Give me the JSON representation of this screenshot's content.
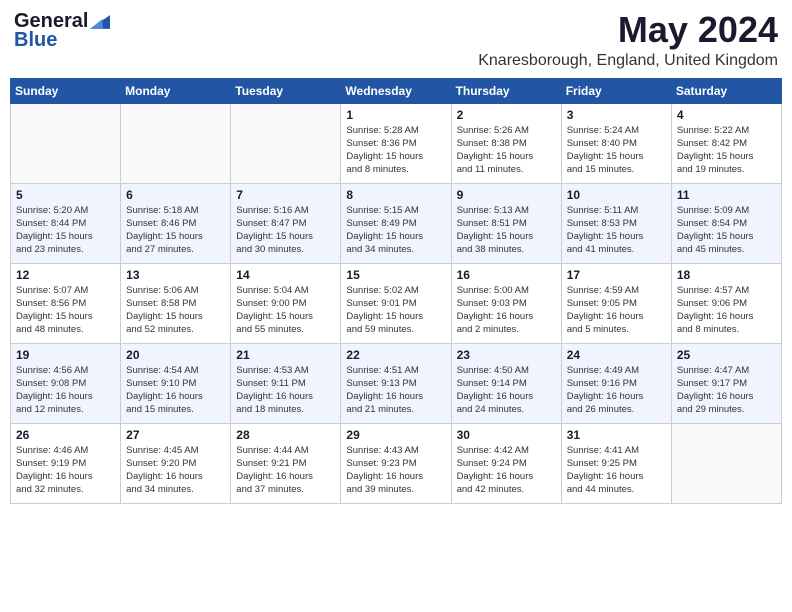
{
  "header": {
    "logo_general": "General",
    "logo_blue": "Blue",
    "month": "May 2024",
    "location": "Knaresborough, England, United Kingdom"
  },
  "days_of_week": [
    "Sunday",
    "Monday",
    "Tuesday",
    "Wednesday",
    "Thursday",
    "Friday",
    "Saturday"
  ],
  "weeks": [
    [
      {
        "day": "",
        "info": ""
      },
      {
        "day": "",
        "info": ""
      },
      {
        "day": "",
        "info": ""
      },
      {
        "day": "1",
        "info": "Sunrise: 5:28 AM\nSunset: 8:36 PM\nDaylight: 15 hours\nand 8 minutes."
      },
      {
        "day": "2",
        "info": "Sunrise: 5:26 AM\nSunset: 8:38 PM\nDaylight: 15 hours\nand 11 minutes."
      },
      {
        "day": "3",
        "info": "Sunrise: 5:24 AM\nSunset: 8:40 PM\nDaylight: 15 hours\nand 15 minutes."
      },
      {
        "day": "4",
        "info": "Sunrise: 5:22 AM\nSunset: 8:42 PM\nDaylight: 15 hours\nand 19 minutes."
      }
    ],
    [
      {
        "day": "5",
        "info": "Sunrise: 5:20 AM\nSunset: 8:44 PM\nDaylight: 15 hours\nand 23 minutes."
      },
      {
        "day": "6",
        "info": "Sunrise: 5:18 AM\nSunset: 8:46 PM\nDaylight: 15 hours\nand 27 minutes."
      },
      {
        "day": "7",
        "info": "Sunrise: 5:16 AM\nSunset: 8:47 PM\nDaylight: 15 hours\nand 30 minutes."
      },
      {
        "day": "8",
        "info": "Sunrise: 5:15 AM\nSunset: 8:49 PM\nDaylight: 15 hours\nand 34 minutes."
      },
      {
        "day": "9",
        "info": "Sunrise: 5:13 AM\nSunset: 8:51 PM\nDaylight: 15 hours\nand 38 minutes."
      },
      {
        "day": "10",
        "info": "Sunrise: 5:11 AM\nSunset: 8:53 PM\nDaylight: 15 hours\nand 41 minutes."
      },
      {
        "day": "11",
        "info": "Sunrise: 5:09 AM\nSunset: 8:54 PM\nDaylight: 15 hours\nand 45 minutes."
      }
    ],
    [
      {
        "day": "12",
        "info": "Sunrise: 5:07 AM\nSunset: 8:56 PM\nDaylight: 15 hours\nand 48 minutes."
      },
      {
        "day": "13",
        "info": "Sunrise: 5:06 AM\nSunset: 8:58 PM\nDaylight: 15 hours\nand 52 minutes."
      },
      {
        "day": "14",
        "info": "Sunrise: 5:04 AM\nSunset: 9:00 PM\nDaylight: 15 hours\nand 55 minutes."
      },
      {
        "day": "15",
        "info": "Sunrise: 5:02 AM\nSunset: 9:01 PM\nDaylight: 15 hours\nand 59 minutes."
      },
      {
        "day": "16",
        "info": "Sunrise: 5:00 AM\nSunset: 9:03 PM\nDaylight: 16 hours\nand 2 minutes."
      },
      {
        "day": "17",
        "info": "Sunrise: 4:59 AM\nSunset: 9:05 PM\nDaylight: 16 hours\nand 5 minutes."
      },
      {
        "day": "18",
        "info": "Sunrise: 4:57 AM\nSunset: 9:06 PM\nDaylight: 16 hours\nand 8 minutes."
      }
    ],
    [
      {
        "day": "19",
        "info": "Sunrise: 4:56 AM\nSunset: 9:08 PM\nDaylight: 16 hours\nand 12 minutes."
      },
      {
        "day": "20",
        "info": "Sunrise: 4:54 AM\nSunset: 9:10 PM\nDaylight: 16 hours\nand 15 minutes."
      },
      {
        "day": "21",
        "info": "Sunrise: 4:53 AM\nSunset: 9:11 PM\nDaylight: 16 hours\nand 18 minutes."
      },
      {
        "day": "22",
        "info": "Sunrise: 4:51 AM\nSunset: 9:13 PM\nDaylight: 16 hours\nand 21 minutes."
      },
      {
        "day": "23",
        "info": "Sunrise: 4:50 AM\nSunset: 9:14 PM\nDaylight: 16 hours\nand 24 minutes."
      },
      {
        "day": "24",
        "info": "Sunrise: 4:49 AM\nSunset: 9:16 PM\nDaylight: 16 hours\nand 26 minutes."
      },
      {
        "day": "25",
        "info": "Sunrise: 4:47 AM\nSunset: 9:17 PM\nDaylight: 16 hours\nand 29 minutes."
      }
    ],
    [
      {
        "day": "26",
        "info": "Sunrise: 4:46 AM\nSunset: 9:19 PM\nDaylight: 16 hours\nand 32 minutes."
      },
      {
        "day": "27",
        "info": "Sunrise: 4:45 AM\nSunset: 9:20 PM\nDaylight: 16 hours\nand 34 minutes."
      },
      {
        "day": "28",
        "info": "Sunrise: 4:44 AM\nSunset: 9:21 PM\nDaylight: 16 hours\nand 37 minutes."
      },
      {
        "day": "29",
        "info": "Sunrise: 4:43 AM\nSunset: 9:23 PM\nDaylight: 16 hours\nand 39 minutes."
      },
      {
        "day": "30",
        "info": "Sunrise: 4:42 AM\nSunset: 9:24 PM\nDaylight: 16 hours\nand 42 minutes."
      },
      {
        "day": "31",
        "info": "Sunrise: 4:41 AM\nSunset: 9:25 PM\nDaylight: 16 hours\nand 44 minutes."
      },
      {
        "day": "",
        "info": ""
      }
    ]
  ]
}
